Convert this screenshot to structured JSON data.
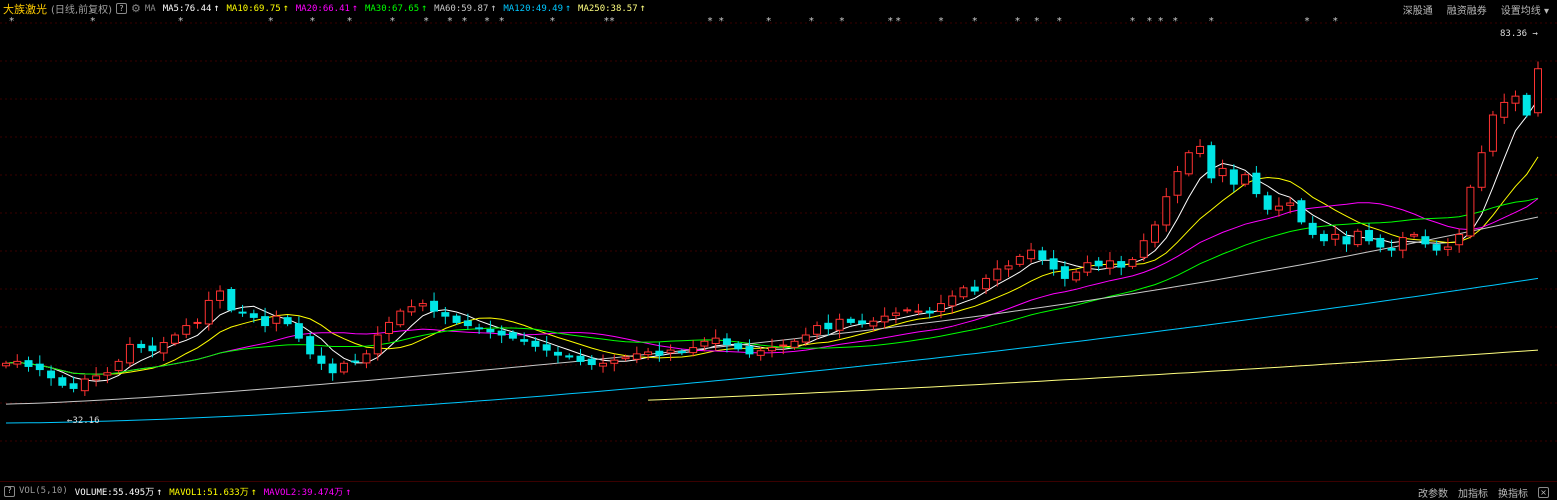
{
  "header": {
    "stock_name": "大族激光",
    "period": "(日线,前复权)",
    "help_icon": "?",
    "ma_label": "MA",
    "ma_items": [
      {
        "label": "MA5:76.44",
        "color": "#ffffff"
      },
      {
        "label": "MA10:69.75",
        "color": "#ffff00"
      },
      {
        "label": "MA20:66.41",
        "color": "#ff00ff"
      },
      {
        "label": "MA30:67.65",
        "color": "#00ff00"
      },
      {
        "label": "MA60:59.87",
        "color": "#c8c8c8"
      },
      {
        "label": "MA120:49.49",
        "color": "#00c8ff"
      },
      {
        "label": "MA250:38.57",
        "color": "#ffff80"
      }
    ],
    "trend_arrow": "↑",
    "menu": [
      "深股通",
      "融资融券",
      "设置均线"
    ]
  },
  "annotations": {
    "high_label": "83.36",
    "low_label": "32.16"
  },
  "footer": {
    "help_icon": "?",
    "vol_label": "VOL(5,10)",
    "vol_items": [
      {
        "label": "VOLUME:55.495万",
        "color": "#ffffff"
      },
      {
        "label": "MAVOL1:51.633万",
        "color": "#ffff00"
      },
      {
        "label": "MAVOL2:39.474万",
        "color": "#ff00ff"
      }
    ],
    "trend_arrow": "↑",
    "menu": [
      "改参数",
      "加指标",
      "换指标"
    ],
    "close_icon": "×"
  },
  "colors": {
    "up": "#ff3232",
    "down": "#00e5e5",
    "grid": "#3a0000",
    "background": "#000000"
  },
  "chart_data": {
    "type": "candlestick",
    "ylim": [
      20,
      90
    ],
    "ma_series": [
      {
        "period": 5,
        "color": "#ffffff"
      },
      {
        "period": 10,
        "color": "#ffff00"
      },
      {
        "period": 20,
        "color": "#ff00ff"
      },
      {
        "period": 30,
        "color": "#00ff00"
      },
      {
        "period": 60,
        "color": "#c8c8c8"
      },
      {
        "period": 120,
        "color": "#00c8ff"
      },
      {
        "period": 250,
        "color": "#ffff80"
      }
    ],
    "close": [
      36.5,
      36.8,
      36.0,
      35.5,
      34.2,
      33.0,
      32.5,
      34.0,
      34.5,
      35.0,
      36.8,
      39.5,
      39.0,
      38.5,
      39.8,
      41.0,
      42.5,
      43.0,
      46.5,
      48.0,
      45.0,
      44.5,
      43.8,
      42.5,
      44.0,
      42.8,
      40.5,
      38.0,
      36.5,
      35.0,
      36.5,
      36.8,
      38.0,
      41.0,
      43.0,
      44.8,
      45.5,
      46.0,
      44.8,
      44.0,
      43.0,
      42.5,
      42.0,
      41.5,
      41.0,
      40.5,
      40.0,
      39.2,
      38.6,
      37.8,
      37.5,
      36.8,
      36.3,
      36.5,
      37.0,
      37.5,
      38.0,
      38.3,
      37.8,
      38.6,
      38.2,
      39.0,
      40.0,
      40.5,
      39.5,
      38.8,
      38.0,
      38.5,
      39.0,
      39.4,
      40.0,
      41.0,
      42.5,
      42.0,
      43.5,
      43.0,
      42.8,
      43.2,
      44.0,
      44.5,
      45.0,
      44.8,
      44.5,
      46.0,
      47.2,
      48.5,
      48.0,
      50.0,
      51.5,
      52.0,
      53.5,
      54.5,
      53.0,
      51.5,
      50.0,
      51.0,
      52.5,
      52.0,
      52.8,
      51.8,
      53.0,
      56.0,
      58.5,
      63.0,
      67.0,
      70.0,
      71.0,
      66.0,
      67.5,
      65.0,
      66.5,
      63.5,
      61.0,
      61.5,
      62.0,
      59.0,
      57.0,
      56.0,
      57.0,
      55.5,
      57.5,
      56.0,
      55.0,
      54.5,
      56.5,
      57.0,
      55.5,
      54.5,
      55.0,
      57.0,
      64.5,
      70.0,
      76.0,
      78.0,
      79.0,
      76.0,
      83.36
    ],
    "ticks_mark": [
      0.5,
      7.7,
      15.5,
      23.5,
      27.2,
      30.5,
      34.3,
      37.3,
      39.4,
      40.7,
      42.7,
      44.0,
      48.5,
      53.3,
      53.8,
      62.5,
      63.5,
      67.7,
      71.5,
      74.2,
      78.5,
      79.2,
      83.0,
      86.0,
      89.8,
      91.5,
      93.5,
      100.0,
      101.5,
      102.5,
      103.8,
      107.0,
      115.5,
      118.0
    ]
  }
}
